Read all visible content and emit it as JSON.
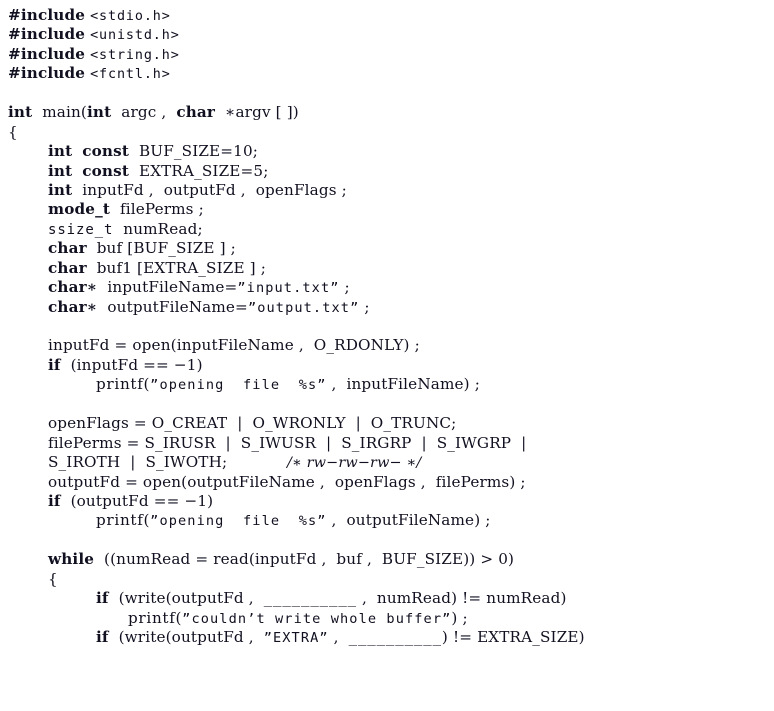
{
  "document": {
    "kind": "source-code-listing",
    "language": "C",
    "background_color": "#ffffff",
    "text_color": "#101020"
  },
  "code": {
    "lines": [
      {
        "indent": 0,
        "tokens": [
          {
            "style": "pp",
            "text": "#include"
          },
          {
            "style": "id",
            "text": " "
          },
          {
            "style": "hdr",
            "text": "<stdio.h>"
          }
        ]
      },
      {
        "indent": 0,
        "tokens": [
          {
            "style": "pp",
            "text": "#include"
          },
          {
            "style": "id",
            "text": " "
          },
          {
            "style": "hdr",
            "text": "<unistd.h>"
          }
        ]
      },
      {
        "indent": 0,
        "tokens": [
          {
            "style": "pp",
            "text": "#include"
          },
          {
            "style": "id",
            "text": " "
          },
          {
            "style": "hdr",
            "text": "<string.h>"
          }
        ]
      },
      {
        "indent": 0,
        "tokens": [
          {
            "style": "pp",
            "text": "#include"
          },
          {
            "style": "id",
            "text": " "
          },
          {
            "style": "hdr",
            "text": "<fcntl.h>"
          }
        ]
      },
      {
        "indent": 0,
        "blank": true,
        "tokens": []
      },
      {
        "indent": 0,
        "tokens": [
          {
            "style": "kw",
            "text": "int"
          },
          {
            "style": "id",
            "text": "  main("
          },
          {
            "style": "kw",
            "text": "int"
          },
          {
            "style": "id",
            "text": "  argc ,  "
          },
          {
            "style": "kw",
            "text": "char"
          },
          {
            "style": "id",
            "text": "  ∗argv [ ])"
          }
        ]
      },
      {
        "indent": 0,
        "tokens": [
          {
            "style": "id",
            "text": "{"
          }
        ]
      },
      {
        "indent": 1,
        "tokens": [
          {
            "style": "kw",
            "text": "int"
          },
          {
            "style": "id",
            "text": "  "
          },
          {
            "style": "kw",
            "text": "const"
          },
          {
            "style": "id",
            "text": "  BUF_SIZE=10;"
          }
        ]
      },
      {
        "indent": 1,
        "tokens": [
          {
            "style": "kw",
            "text": "int"
          },
          {
            "style": "id",
            "text": "  "
          },
          {
            "style": "kw",
            "text": "const"
          },
          {
            "style": "id",
            "text": "  EXTRA_SIZE=5;"
          }
        ]
      },
      {
        "indent": 1,
        "tokens": [
          {
            "style": "kw",
            "text": "int"
          },
          {
            "style": "id",
            "text": "  inputFd ,  outputFd ,  openFlags ;"
          }
        ]
      },
      {
        "indent": 1,
        "tokens": [
          {
            "style": "kw",
            "text": "mode_t"
          },
          {
            "style": "id",
            "text": "  filePerms ;"
          }
        ]
      },
      {
        "indent": 1,
        "tokens": [
          {
            "style": "fill",
            "text": "ssize_t"
          },
          {
            "style": "id",
            "text": "  numRead;"
          }
        ]
      },
      {
        "indent": 1,
        "tokens": [
          {
            "style": "kw",
            "text": "char"
          },
          {
            "style": "id",
            "text": "  buf [BUF_SIZE ] ;"
          }
        ]
      },
      {
        "indent": 1,
        "tokens": [
          {
            "style": "kw",
            "text": "char"
          },
          {
            "style": "id",
            "text": "  buf1 [EXTRA_SIZE ] ;"
          }
        ]
      },
      {
        "indent": 1,
        "tokens": [
          {
            "style": "kw",
            "text": "char∗"
          },
          {
            "style": "id",
            "text": "  inputFileName="
          },
          {
            "style": "str",
            "text": "”input.txt”"
          },
          {
            "style": "id",
            "text": " ;"
          }
        ]
      },
      {
        "indent": 1,
        "tokens": [
          {
            "style": "kw",
            "text": "char∗"
          },
          {
            "style": "id",
            "text": "  outputFileName="
          },
          {
            "style": "str",
            "text": "”output.txt”"
          },
          {
            "style": "id",
            "text": " ;"
          }
        ]
      },
      {
        "indent": 0,
        "blank": true,
        "tokens": []
      },
      {
        "indent": 1,
        "tokens": [
          {
            "style": "id",
            "text": "inputFd = open(inputFileName ,  O_RDONLY) ;"
          }
        ]
      },
      {
        "indent": 1,
        "tokens": [
          {
            "style": "kw",
            "text": "if"
          },
          {
            "style": "id",
            "text": "  (inputFd == −1)"
          }
        ]
      },
      {
        "indent": 2,
        "tokens": [
          {
            "style": "fn",
            "text": "printf("
          },
          {
            "style": "str",
            "text": "”opening  file  %s”"
          },
          {
            "style": "id",
            "text": " ,  inputFileName) ;"
          }
        ]
      },
      {
        "indent": 0,
        "blank": true,
        "tokens": []
      },
      {
        "indent": 1,
        "tokens": [
          {
            "style": "id",
            "text": "openFlags = O_CREAT  |  O_WRONLY  |  O_TRUNC;"
          }
        ]
      },
      {
        "indent": 1,
        "tokens": [
          {
            "style": "id",
            "text": "filePerms = S_IRUSR  |  S_IWUSR  |  S_IRGRP  |  S_IWGRP  |"
          }
        ]
      },
      {
        "indent": 1,
        "tokens": [
          {
            "style": "id",
            "text": "S_IROTH  |  S_IWOTH;"
          },
          {
            "style": "id",
            "text": "            "
          },
          {
            "style": "cmt",
            "text": "/∗ rw−rw−rw− ∗/"
          }
        ]
      },
      {
        "indent": 1,
        "tokens": [
          {
            "style": "id",
            "text": "outputFd = open(outputFileName ,  openFlags ,  filePerms) ;"
          }
        ]
      },
      {
        "indent": 1,
        "tokens": [
          {
            "style": "kw",
            "text": "if"
          },
          {
            "style": "id",
            "text": "  (outputFd == −1)"
          }
        ]
      },
      {
        "indent": 2,
        "tokens": [
          {
            "style": "fn",
            "text": "printf("
          },
          {
            "style": "str",
            "text": "”opening  file  %s”"
          },
          {
            "style": "id",
            "text": " ,  outputFileName) ;"
          }
        ]
      },
      {
        "indent": 0,
        "blank": true,
        "tokens": []
      },
      {
        "indent": 1,
        "tokens": [
          {
            "style": "kw",
            "text": "while"
          },
          {
            "style": "id",
            "text": "  ((numRead = read(inputFd ,  buf ,  BUF_SIZE)) > 0)"
          }
        ]
      },
      {
        "indent": 1,
        "tokens": [
          {
            "style": "id",
            "text": "{"
          }
        ]
      },
      {
        "indent": 2,
        "tokens": [
          {
            "style": "kw",
            "text": "if"
          },
          {
            "style": "id",
            "text": "  (write(outputFd ,  "
          },
          {
            "style": "fill",
            "text": "__________"
          },
          {
            "style": "id",
            "text": " ,  numRead) != numRead)"
          }
        ]
      },
      {
        "indent": 3,
        "tokens": [
          {
            "style": "fn",
            "text": "printf("
          },
          {
            "style": "str",
            "text": "”couldn’t write whole buffer”"
          },
          {
            "style": "id",
            "text": ") ;"
          }
        ]
      },
      {
        "indent": 2,
        "tokens": [
          {
            "style": "kw",
            "text": "if"
          },
          {
            "style": "id",
            "text": "  (write(outputFd ,  "
          },
          {
            "style": "str",
            "text": "”EXTRA”"
          },
          {
            "style": "id",
            "text": " ,  "
          },
          {
            "style": "fill",
            "text": "__________"
          },
          {
            "style": "id",
            "text": ") != EXTRA_SIZE)"
          }
        ]
      }
    ]
  }
}
